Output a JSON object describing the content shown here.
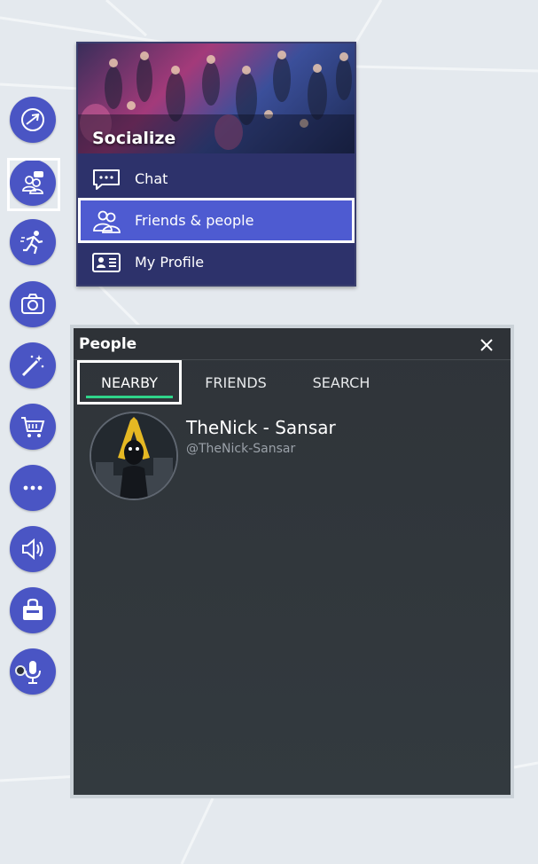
{
  "colors": {
    "accent": "#4a55c4",
    "menu_bg": "#2d326b",
    "active_item": "#4e5bd1",
    "panel_bg": "#2f3439",
    "tab_underline": "#2fd58a"
  },
  "toolbar": {
    "items": [
      {
        "icon": "explore-icon",
        "selected": false
      },
      {
        "icon": "people-icon",
        "selected": true
      },
      {
        "icon": "run-icon",
        "selected": false
      },
      {
        "icon": "camera-icon",
        "selected": false
      },
      {
        "icon": "magic-wand-icon",
        "selected": false
      },
      {
        "icon": "cart-icon",
        "selected": false
      },
      {
        "icon": "more-icon",
        "selected": false
      },
      {
        "icon": "speaker-icon",
        "selected": false
      },
      {
        "icon": "shop-bag-icon",
        "selected": false
      },
      {
        "icon": "microphone-icon",
        "selected": false
      }
    ]
  },
  "social_menu": {
    "title": "Socialize",
    "items": [
      {
        "label": "Chat",
        "icon": "chat-icon",
        "active": false
      },
      {
        "label": "Friends & people",
        "icon": "friends-icon",
        "active": true
      },
      {
        "label": "My Profile",
        "icon": "profile-card-icon",
        "active": false
      }
    ]
  },
  "people_panel": {
    "title": "People",
    "close_icon": "close-icon",
    "tabs": [
      {
        "label": "NEARBY",
        "active": true
      },
      {
        "label": "FRIENDS",
        "active": false
      },
      {
        "label": "SEARCH",
        "active": false
      }
    ],
    "users": [
      {
        "name": "TheNick - Sansar",
        "handle": "@TheNick-Sansar"
      }
    ]
  }
}
